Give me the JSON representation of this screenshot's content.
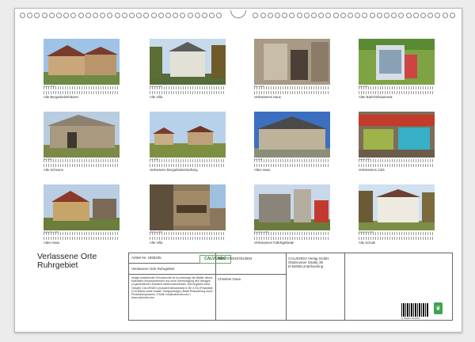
{
  "calendar": {
    "title_line1": "Verlassene Orte",
    "title_line2": "Ruhrgebiet",
    "photos": [
      {
        "month": "Januar 2026",
        "caption": "Alte Bergarbeiterhäuser",
        "scene": "houses"
      },
      {
        "month": "Februar 2026",
        "caption": "Alte Villa",
        "scene": "villa"
      },
      {
        "month": "März 2026",
        "caption": "Verlassenes Haus",
        "scene": "door"
      },
      {
        "month": "April 2026",
        "caption": "Alter Bahnhofsautomat",
        "scene": "booth"
      },
      {
        "month": "Mai 2026",
        "caption": "Alte Scheune",
        "scene": "barn"
      },
      {
        "month": "Juni 2026",
        "caption": "Verlassene Bergarbeitersiedlung",
        "scene": "settlement"
      },
      {
        "month": "Juli 2026",
        "caption": "Altes Haus",
        "scene": "house"
      },
      {
        "month": "August 2026",
        "caption": "Verlassenes Cafe",
        "scene": "cafe"
      },
      {
        "month": "September 2026",
        "caption": "Altes Haus",
        "scene": "ruin"
      },
      {
        "month": "Oktober 2026",
        "caption": "Alte Villa",
        "scene": "balcony"
      },
      {
        "month": "November 2026",
        "caption": "Verlassenes Fabrikgelände",
        "scene": "factory"
      },
      {
        "month": "Dezember 2026",
        "caption": "Alte Schule",
        "scene": "school"
      }
    ],
    "info": {
      "article": "Artikel-Nr. 1995405",
      "logo_text": "CALVENDO",
      "title": "Verlassene Orte Ruhrgebiet",
      "isbn": "ISBN 9783457813553",
      "publisher_line1": "CALVENDO Verlag GmbH",
      "publisher_line2": "Ottobrunner Straße 39",
      "publisher_line3": "D-82008 Unterhaching",
      "author": "Christine Gaus",
      "legal": "Infolge bestehender Schutzrechte ist es untersagt, die Blätter dieses Kalenders herauszutrennen und ohne Genehmigung des Verlages zu gewerblichen Zwecken weiterzuverwenden. Alle Angaben ohne Gewähr. CALVENDO produziert klimaneutral in DE & EU (Postivliste CO2-Bilanz sowie Anzahl Transportwege). Abfall-Reduzierung durch Produktionsprozess. E-Mail: info@calvendo.com • www.calvendo.com",
      "barcode_number": "9 783457 813553"
    },
    "colors": {
      "sheet": "#ffffff",
      "background": "#ececec",
      "eco": "#3fa34d"
    }
  }
}
